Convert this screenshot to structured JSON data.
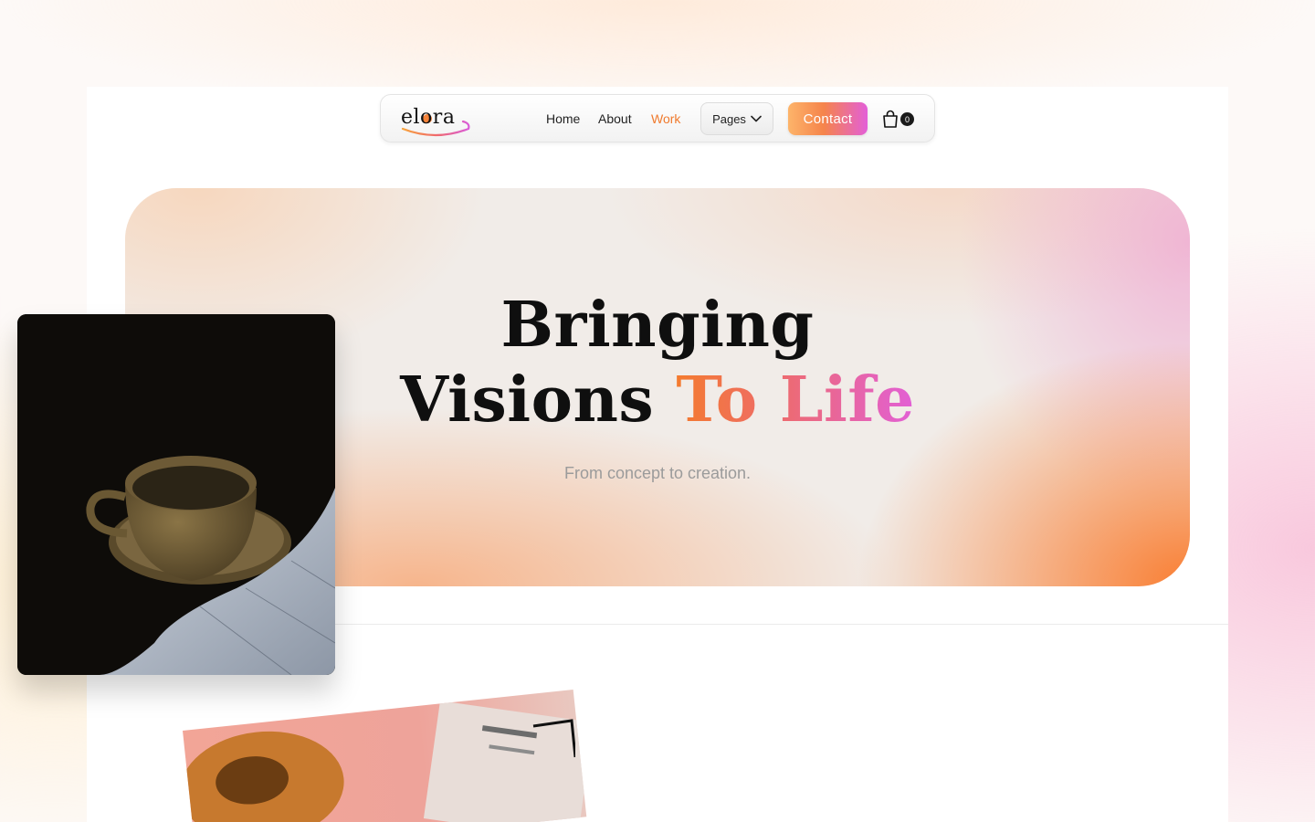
{
  "nav": {
    "logo_text": "elora",
    "links": [
      {
        "label": "Home",
        "active": false
      },
      {
        "label": "About",
        "active": false
      },
      {
        "label": "Work",
        "active": true
      }
    ],
    "pages_label": "Pages",
    "contact_label": "Contact",
    "cart_count": "0"
  },
  "hero": {
    "line1": "Bringing",
    "line2_plain": "Visions",
    "line2_accent": "To Life",
    "subtitle": "From concept to creation."
  },
  "colors": {
    "accent_orange": "#f07a2d",
    "accent_pink": "#e25fd6"
  },
  "icons": {
    "pages_chevron": "chevron-down-icon",
    "cart": "shopping-bag-icon"
  }
}
